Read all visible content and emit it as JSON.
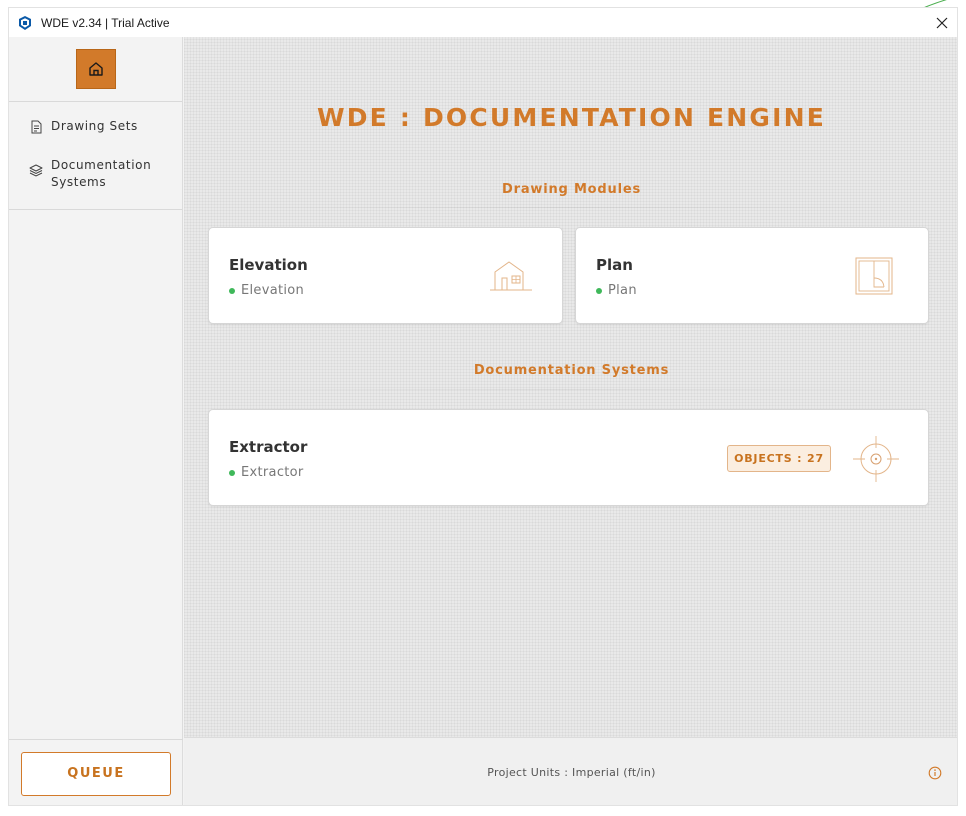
{
  "window": {
    "title": "WDE v2.34 | Trial Active",
    "close_glyph": "✕"
  },
  "sidebar": {
    "items": [
      {
        "label": "Drawing Sets",
        "icon": "document-icon"
      },
      {
        "label": "Documentation Systems",
        "icon": "layers-icon"
      }
    ],
    "queue_label": "QUEUE"
  },
  "main": {
    "heading": "WDE : DOCUMENTATION ENGINE",
    "drawing_modules": {
      "title": "Drawing Modules",
      "cards": [
        {
          "title": "Elevation",
          "status": "Elevation",
          "icon": "house-elevation-icon"
        },
        {
          "title": "Plan",
          "status": "Plan",
          "icon": "floor-plan-icon"
        }
      ]
    },
    "documentation_systems": {
      "title": "Documentation Systems",
      "cards": [
        {
          "title": "Extractor",
          "status": "Extractor",
          "badge": "OBJECTS : 27",
          "icon": "crosshair-icon"
        }
      ]
    }
  },
  "footer": {
    "units": "Project Units : Imperial (ft/in)"
  },
  "colors": {
    "accent": "#d27a2a",
    "status_ok": "#3fb85a"
  }
}
